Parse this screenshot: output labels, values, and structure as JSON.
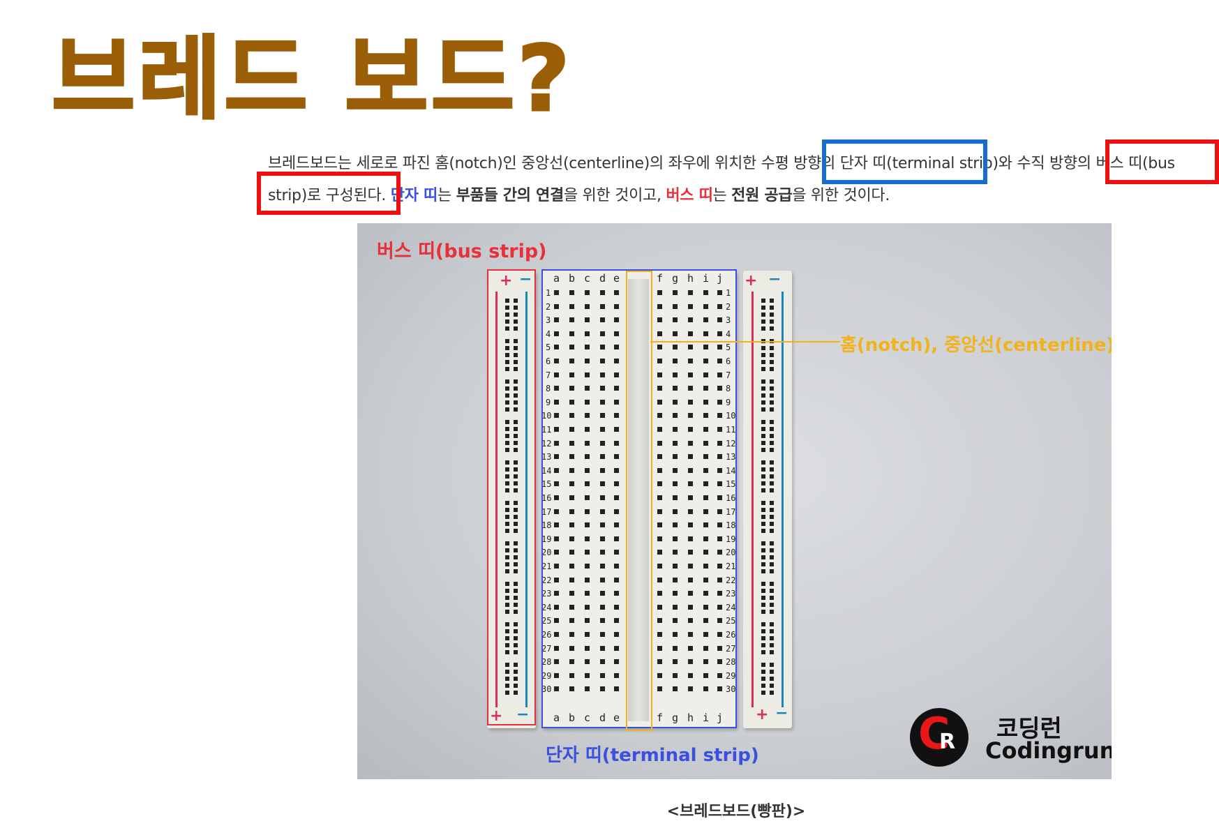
{
  "title": "브레드 보드?",
  "paragraph": {
    "p1": "브레드보드는 세로로 파진 홈(notch)인 중앙선(centerline)의 좌우에 위치한 ",
    "p2": "수평 방향의 단자 띠",
    "p3": "(terminal strip)와 ",
    "p4": "수직 방향의",
    "p5": " ",
    "p6": "버스 띠(bus strip)",
    "p7": "로 구성된다.  ",
    "p8": "단자 띠",
    "p9": "는 ",
    "p10": "부품들 간의 연결",
    "p11": "을 위한 것이고, ",
    "p12": "버스 띠",
    "p13": "는 ",
    "p14": "전원 공급",
    "p15": "을 위한 것이다."
  },
  "photo": {
    "bus_label": "버스 띠(bus strip)",
    "notch_label": "홈(notch), 중앙선(centerline)",
    "terminal_label": "단자 띠(terminal strip)",
    "col_left": [
      "a",
      "b",
      "c",
      "d",
      "e"
    ],
    "col_right": [
      "f",
      "g",
      "h",
      "i",
      "j"
    ],
    "rows": 30,
    "plus": "+",
    "minus": "−"
  },
  "logo": {
    "letter_c": "C",
    "letter_r": "R",
    "korean": "코딩런",
    "english": "Codingrun"
  },
  "caption": "<브레드보드(빵판)>",
  "colors": {
    "title": "#9a5f06",
    "bus_red": "#e8303a",
    "terminal_blue": "#3b4fe0",
    "notch_yellow": "#f2b21c",
    "highlight_blue": "#1570c4",
    "highlight_red": "#ee1010"
  }
}
